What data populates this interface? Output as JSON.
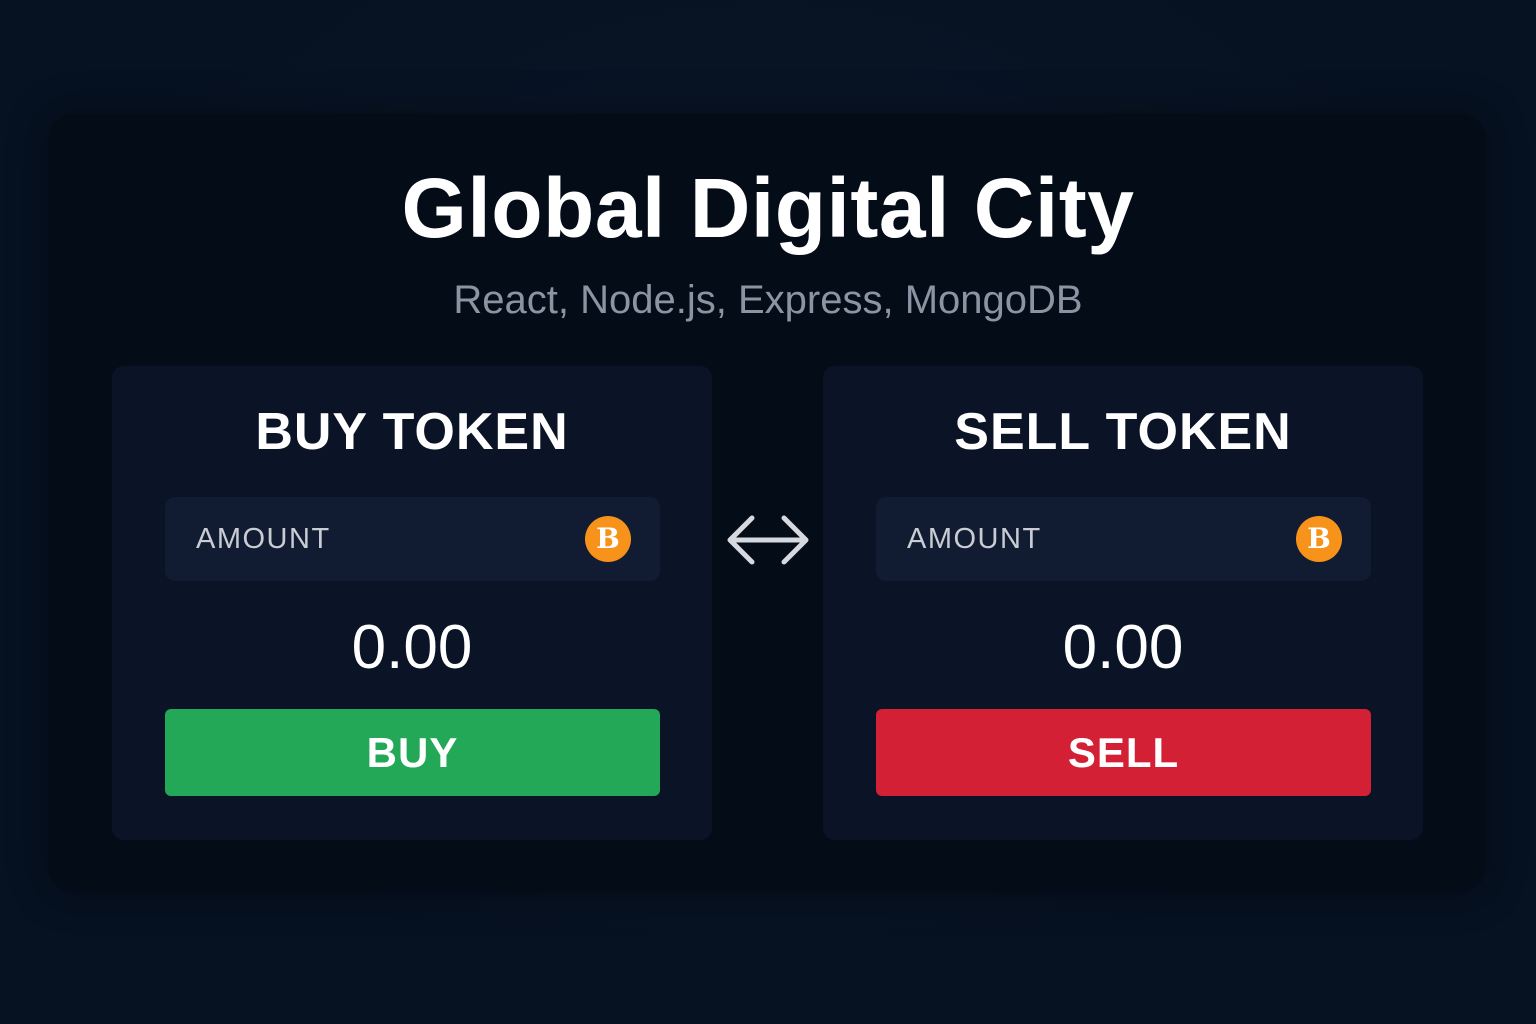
{
  "app": {
    "title": "Global Digital City",
    "subtitle": "React, Node.js, Express, MongoDB"
  },
  "buy_panel": {
    "title": "BUY TOKEN",
    "amount_label": "AMOUNT",
    "coin_icon": "bitcoin-icon",
    "coin_symbol": "B",
    "value": "0.00",
    "button_label": "BUY",
    "button_color": "#23a857"
  },
  "sell_panel": {
    "title": "SELL TOKEN",
    "amount_label": "AMOUNT",
    "coin_icon": "bitcoin-icon",
    "coin_symbol": "B",
    "value": "0.00",
    "button_label": "SELL",
    "button_color": "#d32035"
  },
  "swap_icon": "swap-arrows-icon",
  "colors": {
    "background": "#061121",
    "card": "#040c18",
    "panel": "#0a1426",
    "field": "#111c33",
    "coin": "#f7931a"
  }
}
